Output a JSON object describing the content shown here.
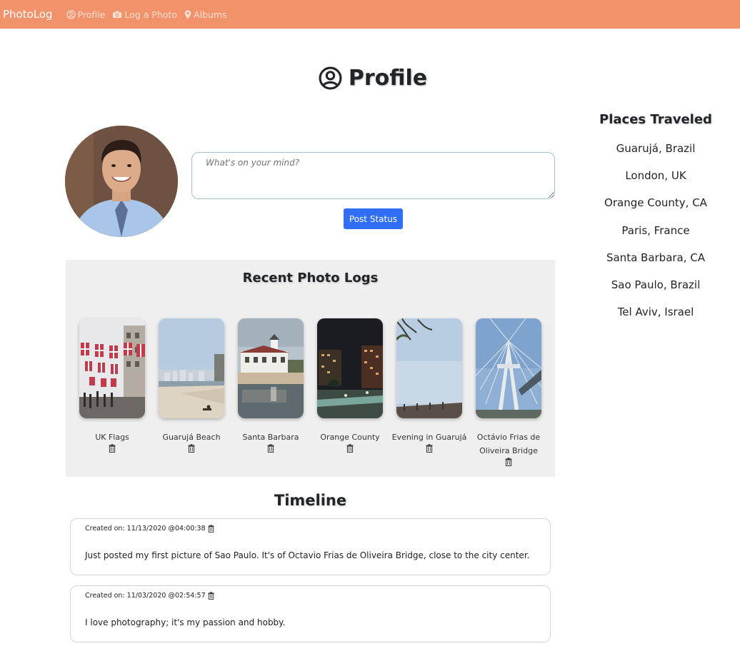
{
  "nav": {
    "brand": "PhotoLog",
    "links": [
      {
        "label": "Profile",
        "icon": "user-circle-icon"
      },
      {
        "label": "Log a Photo",
        "icon": "camera-icon"
      },
      {
        "label": "Albums",
        "icon": "map-pin-icon"
      }
    ],
    "bg_color": "#f2926b"
  },
  "page": {
    "title": "Profile",
    "icon": "user-circle-icon"
  },
  "status": {
    "placeholder": "What's on your mind?",
    "button_label": "Post Status"
  },
  "places": {
    "title": "Places Traveled",
    "items": [
      "Guarujá, Brazil",
      "London, UK",
      "Orange County, CA",
      "Paris, France",
      "Santa Barbara, CA",
      "Sao Paulo, Brazil",
      "Tel Aviv, Israel"
    ]
  },
  "recent": {
    "title": "Recent Photo Logs",
    "photos": [
      {
        "caption": "UK Flags"
      },
      {
        "caption": "Guarujá Beach"
      },
      {
        "caption": "Santa Barbara"
      },
      {
        "caption": "Orange County"
      },
      {
        "caption": "Evening in Guarujá"
      },
      {
        "caption": "Octávio Frias de Oliveira Bridge"
      }
    ]
  },
  "timeline": {
    "title": "Timeline",
    "posts": [
      {
        "meta": "Created on: 11/13/2020 @04:00:38",
        "text": "Just posted my first picture of Sao Paulo. It's of Octavio Frias de Oliveira Bridge, close to the city center."
      },
      {
        "meta": "Created on: 11/03/2020 @02:54:57",
        "text": "I love photography; it's my passion and hobby."
      }
    ]
  }
}
